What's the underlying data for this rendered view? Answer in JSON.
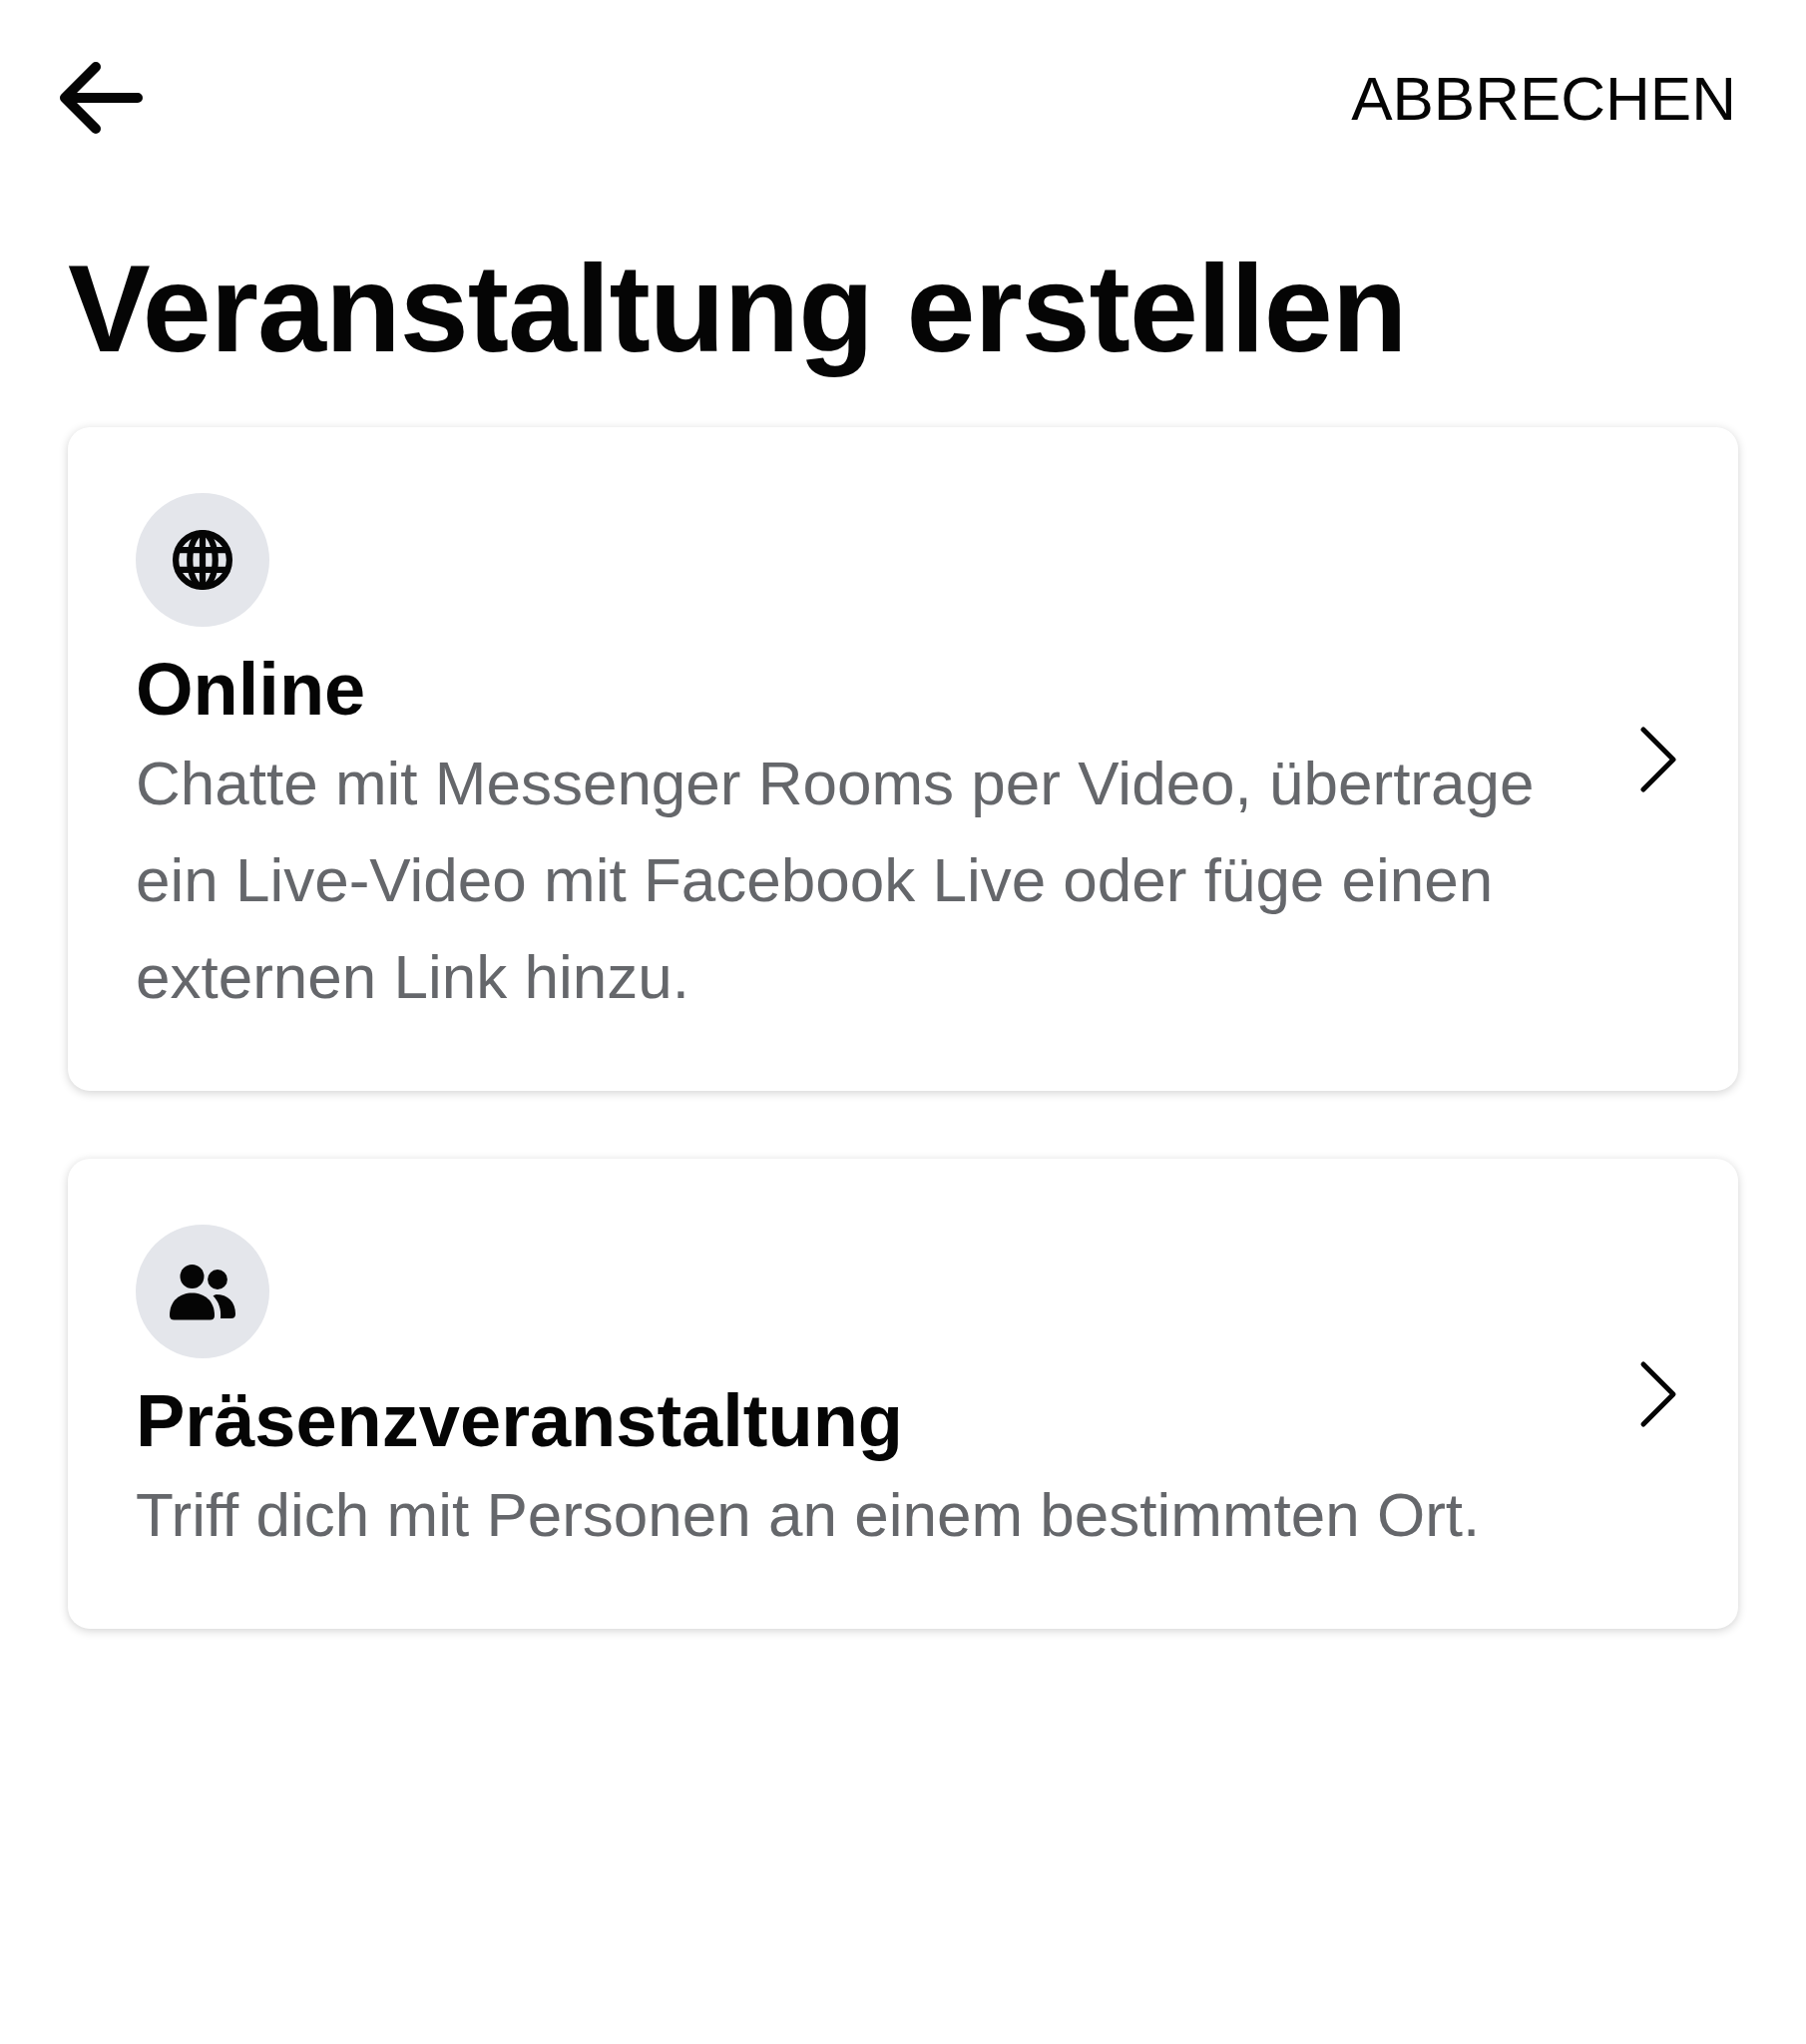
{
  "header": {
    "cancel": "ABBRECHEN"
  },
  "title": "Veranstaltung erstellen",
  "options": [
    {
      "kind": "online",
      "title": "Online",
      "description": "Chatte mit Messenger Rooms per Video, übertrage ein Live-Video mit Facebook Live oder füge einen externen Link hinzu."
    },
    {
      "kind": "in_person",
      "title": "Präsenzveranstaltung",
      "description": "Triff dich mit Personen an einem bestimmten Ort."
    }
  ]
}
